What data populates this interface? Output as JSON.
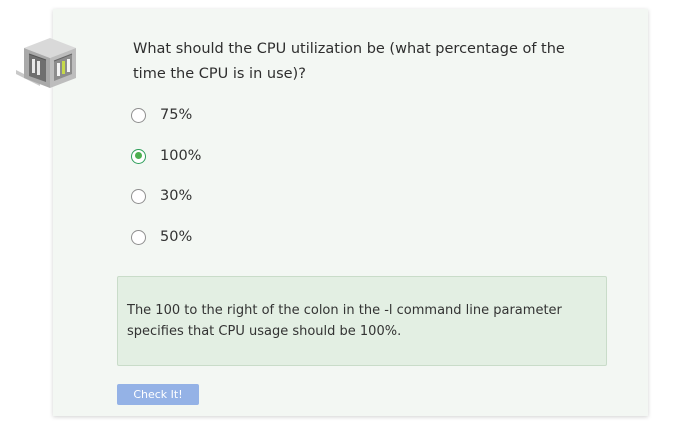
{
  "question": {
    "text": "What should the CPU utilization be (what percentage of the time the CPU is in use)?"
  },
  "options": [
    {
      "label": "75%",
      "selected": false
    },
    {
      "label": "100%",
      "selected": true
    },
    {
      "label": "30%",
      "selected": false
    },
    {
      "label": "50%",
      "selected": false
    }
  ],
  "feedback": {
    "text": "The 100 to the right of the colon in the -l command line parameter specifies that CPU usage should be 100%."
  },
  "check_button": {
    "label": "Check It!"
  },
  "colors": {
    "selected_radio": "#4caf50",
    "feedback_bg": "#e3efe3",
    "button_bg": "#94b2e6"
  },
  "icons": {
    "logo": "server-rack-logo-icon"
  }
}
